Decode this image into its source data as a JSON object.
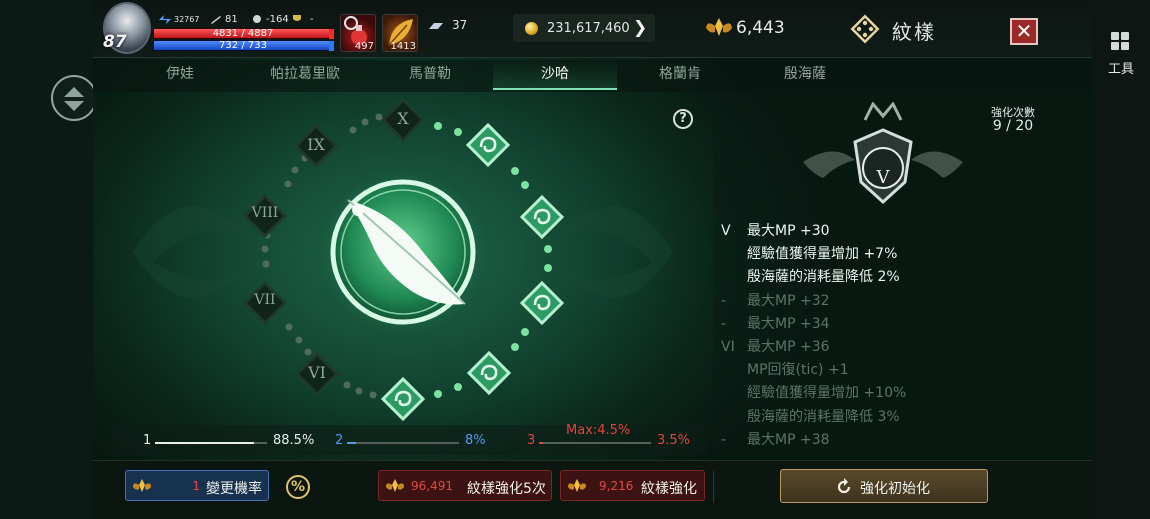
{
  "side": {
    "tools_label": "工具"
  },
  "player": {
    "level": "87",
    "power": "32767",
    "stat_sword": "81",
    "stat_skull": "-164",
    "stat_trophy": "-",
    "hp_text": "4831 / 4887",
    "hp_fraction": 0.988,
    "mp_text": "732 / 733",
    "mp_fraction": 0.998
  },
  "items": {
    "potion_count": "497",
    "leaf_count": "1413"
  },
  "currency": {
    "silver": "37",
    "gold": "231,617,460",
    "crystal": "6,443"
  },
  "screen": {
    "title": "紋樣"
  },
  "tabs": [
    {
      "label": "伊娃",
      "active": false
    },
    {
      "label": "帕拉葛里歐",
      "active": false
    },
    {
      "label": "馬普勒",
      "active": false
    },
    {
      "label": "沙哈",
      "active": true
    },
    {
      "label": "格蘭肯",
      "active": false
    },
    {
      "label": "殷海薩",
      "active": false
    }
  ],
  "wheel": {
    "roman_numerals": [
      "X",
      "IX",
      "VIII",
      "VII",
      "VI"
    ],
    "help": "?"
  },
  "panel": {
    "enhance_label": "強化次數",
    "enhance_value": "9 / 20",
    "badge_numeral": "V",
    "stats": [
      {
        "tier": "V",
        "text": "最大MP +30",
        "active": true
      },
      {
        "tier": "",
        "text": "經驗值獲得量增加 +7%",
        "active": true
      },
      {
        "tier": "",
        "text": "殷海薩的消耗量降低 2%",
        "active": true
      },
      {
        "tier": "-",
        "text": "最大MP +32",
        "active": false
      },
      {
        "tier": "-",
        "text": "最大MP +34",
        "active": false
      },
      {
        "tier": "VI",
        "text": "最大MP +36",
        "active": false
      },
      {
        "tier": "",
        "text": "MP回復(tic) +1",
        "active": false
      },
      {
        "tier": "",
        "text": "經驗值獲得量增加 +10%",
        "active": false
      },
      {
        "tier": "",
        "text": "殷海薩的消耗量降低 3%",
        "active": false
      },
      {
        "tier": "-",
        "text": "最大MP +38",
        "active": false
      }
    ]
  },
  "progress": [
    {
      "num": "1",
      "pct": "88.5%",
      "value": 0.885,
      "color": "#e8efeb"
    },
    {
      "num": "2",
      "pct": "8%",
      "value": 0.08,
      "color": "#4f9bf0"
    },
    {
      "num": "3",
      "pct": "3.5%",
      "value": 0.035,
      "color": "#e3443e",
      "max": "Max:4.5%"
    }
  ],
  "bottom": {
    "change_rate_cost": "1",
    "change_rate_label": "變更機率",
    "percent_icon": "%",
    "enhance5_cost": "96,491",
    "enhance5_label": "紋樣強化5次",
    "enhance_cost": "9,216",
    "enhance_label": "紋樣強化",
    "reset_label": "強化初始化"
  },
  "colors": {
    "accent_green": "#7fe0b4",
    "hp_red": "#c1141a",
    "mp_blue": "#1646c4",
    "cost_red": "#e14b44",
    "gold": "#e2c366"
  },
  "icons": [
    "scroll-toggle-icon",
    "grid-icon",
    "avatar",
    "power-icon",
    "sword-icon",
    "skull-icon",
    "trophy-icon",
    "potion-icon",
    "leaf-icon",
    "silver-icon",
    "gold-coin-icon",
    "crystal-wings-icon",
    "glyph-icon",
    "close-icon",
    "feather-icon",
    "help-icon",
    "rank-badge-icon",
    "refresh-icon",
    "percent-icon"
  ]
}
